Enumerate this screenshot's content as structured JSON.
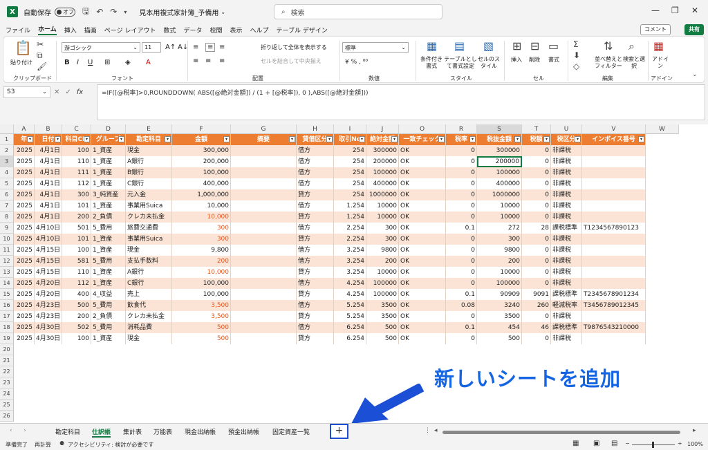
{
  "titlebar": {
    "autosave": "自動保存",
    "toggle": "オフ",
    "filename": "見本用複式家計簿_予備用",
    "search": "検索"
  },
  "menu": [
    "ファイル",
    "ホーム",
    "挿入",
    "描画",
    "ページ レイアウト",
    "数式",
    "データ",
    "校閲",
    "表示",
    "ヘルプ",
    "テーブル デザイン"
  ],
  "comment": "コメント",
  "share": "共有",
  "ribbon": {
    "clipboard": "クリップボード",
    "paste": "貼り付け",
    "font": "フォント",
    "font_name": "游ゴシック",
    "font_size": "11",
    "align": "配置",
    "wrap": "折り返して全体を表示する",
    "merge": "セルを結合して中央揃え",
    "number": "数値",
    "number_format": "標準",
    "style": "スタイル",
    "cond": "条件付き書式",
    "table": "テーブルとして書式設定",
    "cellstyle": "セルのスタイル",
    "cells": "セル",
    "insert": "挿入",
    "delete": "削除",
    "format": "書式",
    "edit": "編集",
    "sort": "並べ替えとフィルター",
    "find": "検索と選択",
    "addin": "アドイン",
    "addin_btn": "アドイン"
  },
  "namebox": "S3",
  "formula": "=IF([@税率]>0,ROUNDDOWN( ABS([@絶対金額]) / (1 + [@税率]), 0 ),ABS([@絶対金額]))",
  "columns": [
    "A",
    "B",
    "C",
    "D",
    "E",
    "F",
    "G",
    "H",
    "I",
    "J",
    "O",
    "R",
    "S",
    "T",
    "U",
    "V",
    "W"
  ],
  "headers": [
    "年",
    "日付",
    "科目CD",
    "グループ",
    "勘定科目",
    "金額",
    "摘要",
    "貸借区分",
    "取引No",
    "絶対金額",
    "一致チェック",
    "税率",
    "税抜金額",
    "税額",
    "税区分",
    "インボイス番号"
  ],
  "rows": [
    [
      "2025",
      "4月1日",
      "100",
      "1_資産",
      "現金",
      "300,000",
      "",
      "借方",
      "254",
      "300000",
      "OK",
      "0",
      "300000",
      "0",
      "非課税",
      ""
    ],
    [
      "2025",
      "4月1日",
      "110",
      "1_資産",
      "A銀行",
      "200,000",
      "",
      "借方",
      "254",
      "200000",
      "OK",
      "0",
      "200000",
      "0",
      "非課税",
      ""
    ],
    [
      "2025",
      "4月1日",
      "111",
      "1_資産",
      "B銀行",
      "100,000",
      "",
      "借方",
      "254",
      "100000",
      "OK",
      "0",
      "100000",
      "0",
      "非課税",
      ""
    ],
    [
      "2025",
      "4月1日",
      "112",
      "1_資産",
      "C銀行",
      "400,000",
      "",
      "借方",
      "254",
      "400000",
      "OK",
      "0",
      "400000",
      "0",
      "非課税",
      ""
    ],
    [
      "2025",
      "4月1日",
      "300",
      "3_純資産",
      "元入金",
      "1,000,000",
      "",
      "貸方",
      "254",
      "1000000",
      "OK",
      "0",
      "1000000",
      "0",
      "非課税",
      ""
    ],
    [
      "2025",
      "4月1日",
      "101",
      "1_資産",
      "事業用Suica",
      "10,000",
      "",
      "借方",
      "1.254",
      "10000",
      "OK",
      "0",
      "10000",
      "0",
      "非課税",
      ""
    ],
    [
      "2025",
      "4月1日",
      "200",
      "2_負債",
      "クレカ未払金",
      "10,000",
      "",
      "貸方",
      "1.254",
      "10000",
      "OK",
      "0",
      "10000",
      "0",
      "非課税",
      ""
    ],
    [
      "2025",
      "4月10日",
      "501",
      "5_費用",
      "旅費交通費",
      "300",
      "",
      "借方",
      "2.254",
      "300",
      "OK",
      "0.1",
      "272",
      "28",
      "課税標準",
      "T1234567890123"
    ],
    [
      "2025",
      "4月10日",
      "101",
      "1_資産",
      "事業用Suica",
      "300",
      "",
      "貸方",
      "2.254",
      "300",
      "OK",
      "0",
      "300",
      "0",
      "非課税",
      ""
    ],
    [
      "2025",
      "4月15日",
      "100",
      "1_資産",
      "現金",
      "9,800",
      "",
      "借方",
      "3.254",
      "9800",
      "OK",
      "0",
      "9800",
      "0",
      "非課税",
      ""
    ],
    [
      "2025",
      "4月15日",
      "581",
      "5_費用",
      "支払手数料",
      "200",
      "",
      "借方",
      "3.254",
      "200",
      "OK",
      "0",
      "200",
      "0",
      "非課税",
      ""
    ],
    [
      "2025",
      "4月15日",
      "110",
      "1_資産",
      "A銀行",
      "10,000",
      "",
      "貸方",
      "3.254",
      "10000",
      "OK",
      "0",
      "10000",
      "0",
      "非課税",
      ""
    ],
    [
      "2025",
      "4月20日",
      "112",
      "1_資産",
      "C銀行",
      "100,000",
      "",
      "借方",
      "4.254",
      "100000",
      "OK",
      "0",
      "100000",
      "0",
      "非課税",
      ""
    ],
    [
      "2025",
      "4月20日",
      "400",
      "4_収益",
      "売上",
      "100,000",
      "",
      "貸方",
      "4.254",
      "100000",
      "OK",
      "0.1",
      "90909",
      "9091",
      "課税標準",
      "T2345678901234"
    ],
    [
      "2025",
      "4月23日",
      "500",
      "5_費用",
      "飲食代",
      "3,500",
      "",
      "借方",
      "5.254",
      "3500",
      "OK",
      "0.08",
      "3240",
      "260",
      "軽減税率",
      "T3456789012345"
    ],
    [
      "2025",
      "4月23日",
      "200",
      "2_負債",
      "クレカ未払金",
      "3,500",
      "",
      "貸方",
      "5.254",
      "3500",
      "OK",
      "0",
      "3500",
      "0",
      "非課税",
      ""
    ],
    [
      "2025",
      "4月30日",
      "502",
      "5_費用",
      "消耗品費",
      "500",
      "",
      "借方",
      "6.254",
      "500",
      "OK",
      "0.1",
      "454",
      "46",
      "課税標準",
      "T9876543210000"
    ],
    [
      "2025",
      "4月30日",
      "100",
      "1_資産",
      "現金",
      "500",
      "",
      "貸方",
      "6.254",
      "500",
      "OK",
      "0",
      "500",
      "0",
      "非課税",
      ""
    ]
  ],
  "red_rows": [
    6,
    7,
    8,
    10,
    11,
    14,
    15,
    16,
    17
  ],
  "row_numbers": [
    "1",
    "2",
    "3",
    "4",
    "5",
    "6",
    "7",
    "8",
    "9",
    "10",
    "11",
    "12",
    "13",
    "14",
    "15",
    "16",
    "17",
    "18",
    "19",
    "20",
    "21",
    "22",
    "23",
    "24",
    "25",
    "26"
  ],
  "sheets": [
    "勘定科目",
    "仕訳帳",
    "集計表",
    "万能表",
    "現金出納帳",
    "預金出納帳",
    "固定資産一覧"
  ],
  "active_sheet": "仕訳帳",
  "add_sheet": "+",
  "status": {
    "ready": "準備完了",
    "recalc": "再計算",
    "accessibility": "アクセシビリティ: 検討が必要です",
    "zoom": "100%"
  },
  "annotation": "新しいシートを追加",
  "colors": {
    "header": "#ed7d31",
    "band": "#fbe4d5",
    "accent": "#107c41",
    "arrow": "#1a4fd6",
    "annotation": "#1565e3"
  }
}
